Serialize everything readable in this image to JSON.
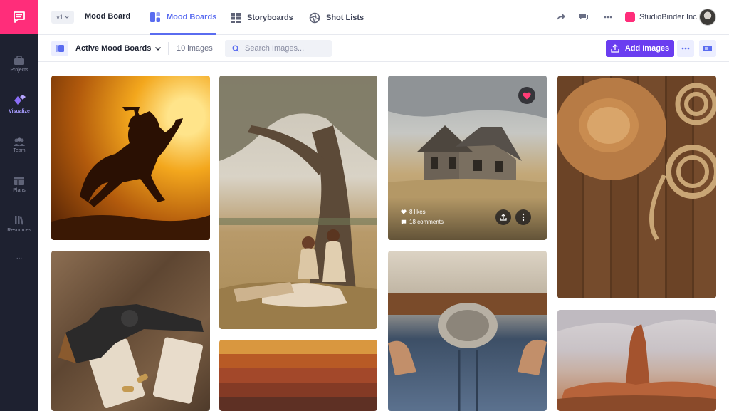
{
  "sidebar": {
    "items": [
      {
        "label": "Projects",
        "icon": "briefcase-icon"
      },
      {
        "label": "Visualize",
        "icon": "visualize-icon"
      },
      {
        "label": "Team",
        "icon": "team-icon"
      },
      {
        "label": "Plans",
        "icon": "plans-icon"
      },
      {
        "label": "Resources",
        "icon": "resources-icon"
      }
    ],
    "more": "..."
  },
  "topbar": {
    "version": "v1",
    "title": "Mood Board",
    "tabs": [
      {
        "label": "Mood Boards",
        "icon": "mood-boards-icon",
        "active": true
      },
      {
        "label": "Storyboards",
        "icon": "storyboards-icon",
        "active": false
      },
      {
        "label": "Shot Lists",
        "icon": "shot-lists-icon",
        "active": false
      }
    ],
    "company": "StudioBinder Inc"
  },
  "toolbar": {
    "board_select": "Active Mood Boards",
    "image_count": "10 images",
    "search_placeholder": "Search Images...",
    "add_button": "Add Images"
  },
  "card": {
    "likes": "8 likes",
    "comments": "18 comments"
  },
  "colors": {
    "accent": "#5a6cf0",
    "brand": "#ff2d7a",
    "primary_button": "#6a3df0",
    "sidebar_bg": "#1e2130",
    "palette": [
      "#d9973f",
      "#b85a25",
      "#a3482a",
      "#843a25",
      "#5e3024"
    ]
  }
}
